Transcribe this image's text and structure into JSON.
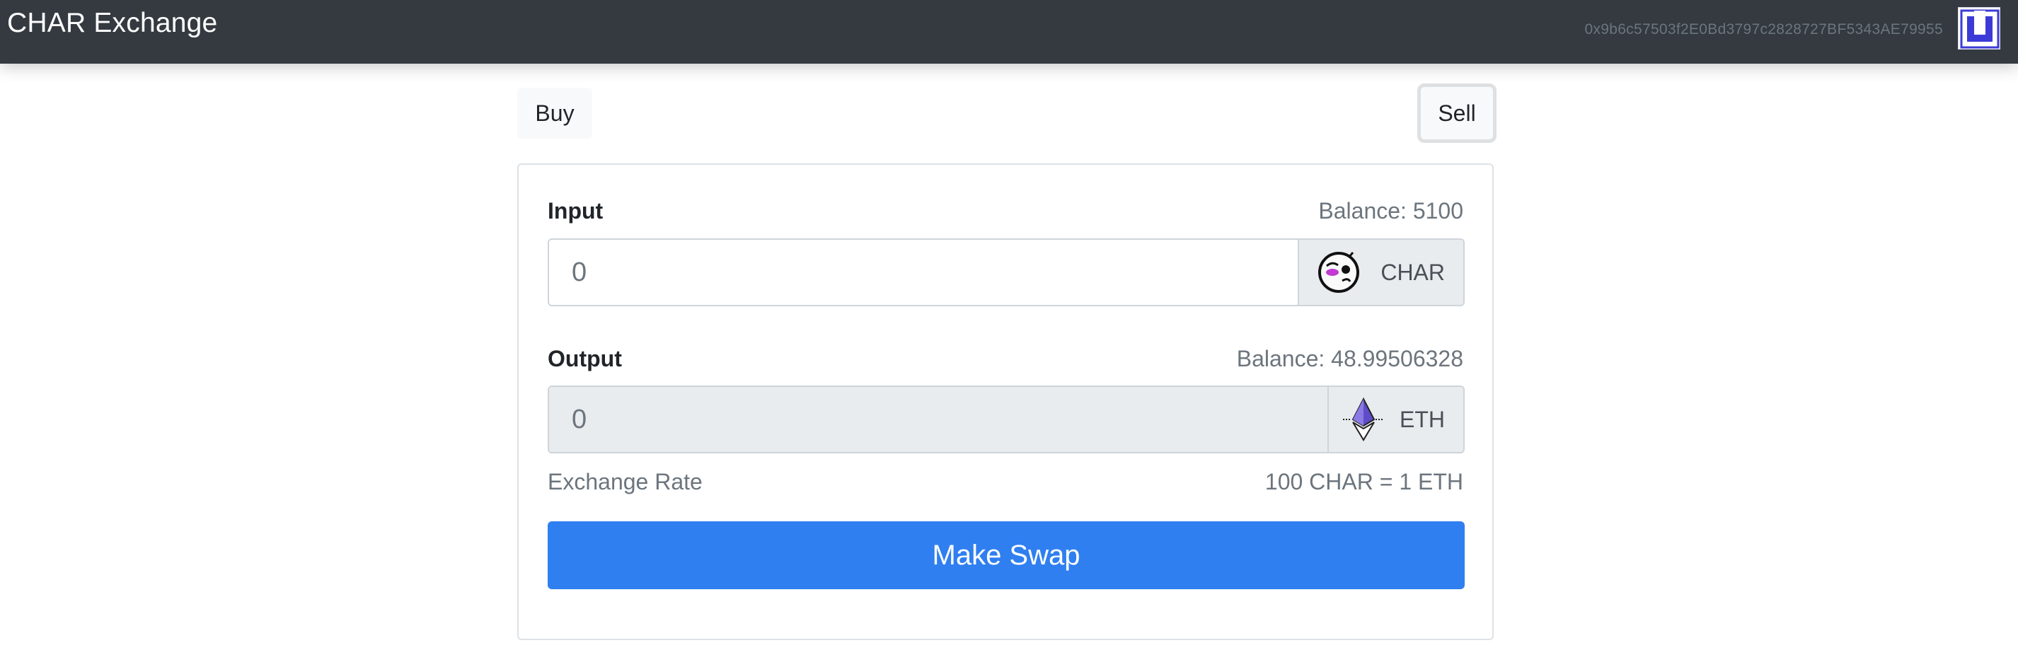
{
  "header": {
    "brand": "CHAR Exchange",
    "account": "0x9b6c57503f2E0Bd3797c2828727BF5343AE79955",
    "avatar_icon": "uniswap-logo-icon"
  },
  "tabs": {
    "buy_label": "Buy",
    "sell_label": "Sell",
    "active": "Sell"
  },
  "input": {
    "label": "Input",
    "balance": "Balance: 5100",
    "placeholder": "0",
    "token": "CHAR",
    "token_icon": "char-token-icon"
  },
  "output": {
    "label": "Output",
    "balance": "Balance: 48.99506328",
    "placeholder": "0",
    "token": "ETH",
    "token_icon": "ethereum-icon"
  },
  "rate": {
    "label": "Exchange Rate",
    "value": "100 CHAR = 1 ETH"
  },
  "swap_button": "Make Swap",
  "colors": {
    "navbar": "#343a40",
    "primary": "#2f7ff0",
    "muted": "#6c757d"
  }
}
